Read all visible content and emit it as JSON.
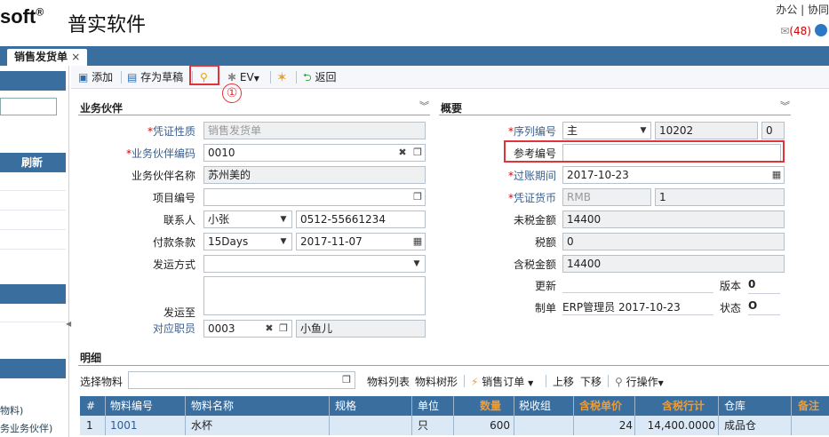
{
  "header": {
    "logo_text": "soft",
    "logo_mark": "®",
    "brand": "普实软件",
    "top_links": "办公 | 协同",
    "mail_count": "(48)"
  },
  "tabs": [
    {
      "label": "销售发货单",
      "close": "×"
    }
  ],
  "sidebar": {
    "refresh_label": "刷新",
    "item1": "物料)",
    "item2": "务业务伙伴)"
  },
  "toolbar": {
    "add": "添加",
    "save_draft": "存为草稿",
    "ev": "EV",
    "back": "返回",
    "annotation": "①"
  },
  "partner_section": {
    "title": "业务伙伴",
    "fields": {
      "voucher_type_label": "凭证性质",
      "voucher_type_value": "销售发货单",
      "partner_code_label": "业务伙伴编码",
      "partner_code_value": "0010",
      "partner_name_label": "业务伙伴名称",
      "partner_name_value": "苏州美的",
      "project_label": "项目编号",
      "contact_label": "联系人",
      "contact_value": "小张",
      "contact_phone": "0512-55661234",
      "pay_terms_label": "付款条款",
      "pay_terms_value": "15Days",
      "pay_date": "2017-11-07",
      "ship_method_label": "发运方式",
      "ship_to_label": "发运至",
      "staff_label": "对应职员",
      "staff_code": "0003",
      "staff_name": "小鱼儿"
    }
  },
  "overview_section": {
    "title": "概要",
    "fields": {
      "serial_label": "序列编号",
      "serial_type": "主",
      "serial_no": "10202",
      "serial_extra": "0",
      "ref_label": "参考编号",
      "post_date_label": "过账期间",
      "post_date": "2017-10-23",
      "currency_label": "凭证货币",
      "currency": "RMB",
      "rate": "1",
      "pretax_label": "未税金额",
      "pretax": "14400",
      "tax_label": "税额",
      "tax": "0",
      "total_label": "含税金额",
      "total": "14400",
      "update_label": "更新",
      "version_label": "版本",
      "version": "0",
      "creator_label": "制单",
      "creator": "ERP管理员 2017-10-23",
      "status_label": "状态",
      "status": "O"
    }
  },
  "details": {
    "title": "明细",
    "select_label": "选择物料",
    "links": [
      "物料列表",
      "物料树形"
    ],
    "sales_order": "销售订单",
    "move_up": "上移",
    "move_down": "下移",
    "row_ops": "行操作",
    "columns": [
      "#",
      "物料编号",
      "物料名称",
      "规格",
      "单位",
      "数量",
      "税收组",
      "含税单价",
      "含税行计",
      "仓库",
      "备注"
    ],
    "rows": [
      {
        "idx": "1",
        "code": "1001",
        "name": "水杯",
        "spec": "",
        "unit": "只",
        "qty": "600",
        "tax_group": "",
        "price": "24",
        "line_total": "14,400.0000",
        "warehouse": "成品仓",
        "note": ""
      }
    ]
  }
}
